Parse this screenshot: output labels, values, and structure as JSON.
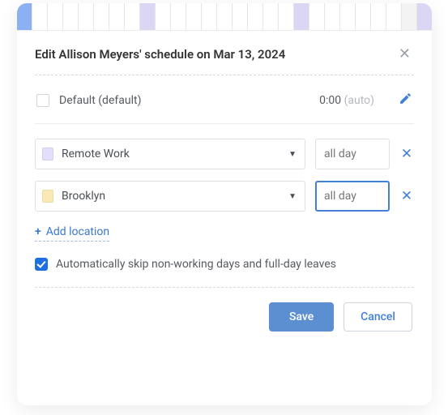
{
  "dialog": {
    "title": "Edit Allison Meyers' schedule on Mar 13, 2024"
  },
  "defaultRow": {
    "label": "Default (default)",
    "time": "0:00",
    "timeSuffix": "(auto)"
  },
  "locations": [
    {
      "name": "Remote Work",
      "swatch": "purple",
      "duration_placeholder": "all day",
      "focused": false
    },
    {
      "name": "Brooklyn",
      "swatch": "yellow",
      "duration_placeholder": "all day",
      "focused": true
    }
  ],
  "addLocation": {
    "label": "Add location"
  },
  "autoSkip": {
    "checked": true,
    "label": "Automatically skip non-working days and full-day leaves"
  },
  "footer": {
    "save": "Save",
    "cancel": "Cancel"
  },
  "strip": {
    "cells": [
      "blue",
      "",
      "",
      "",
      "",
      "",
      "",
      "",
      "lav",
      "",
      "",
      "",
      "",
      "",
      "",
      "",
      "",
      "",
      "lav",
      "",
      "",
      "",
      "",
      "",
      "",
      "grey",
      "lav"
    ]
  }
}
